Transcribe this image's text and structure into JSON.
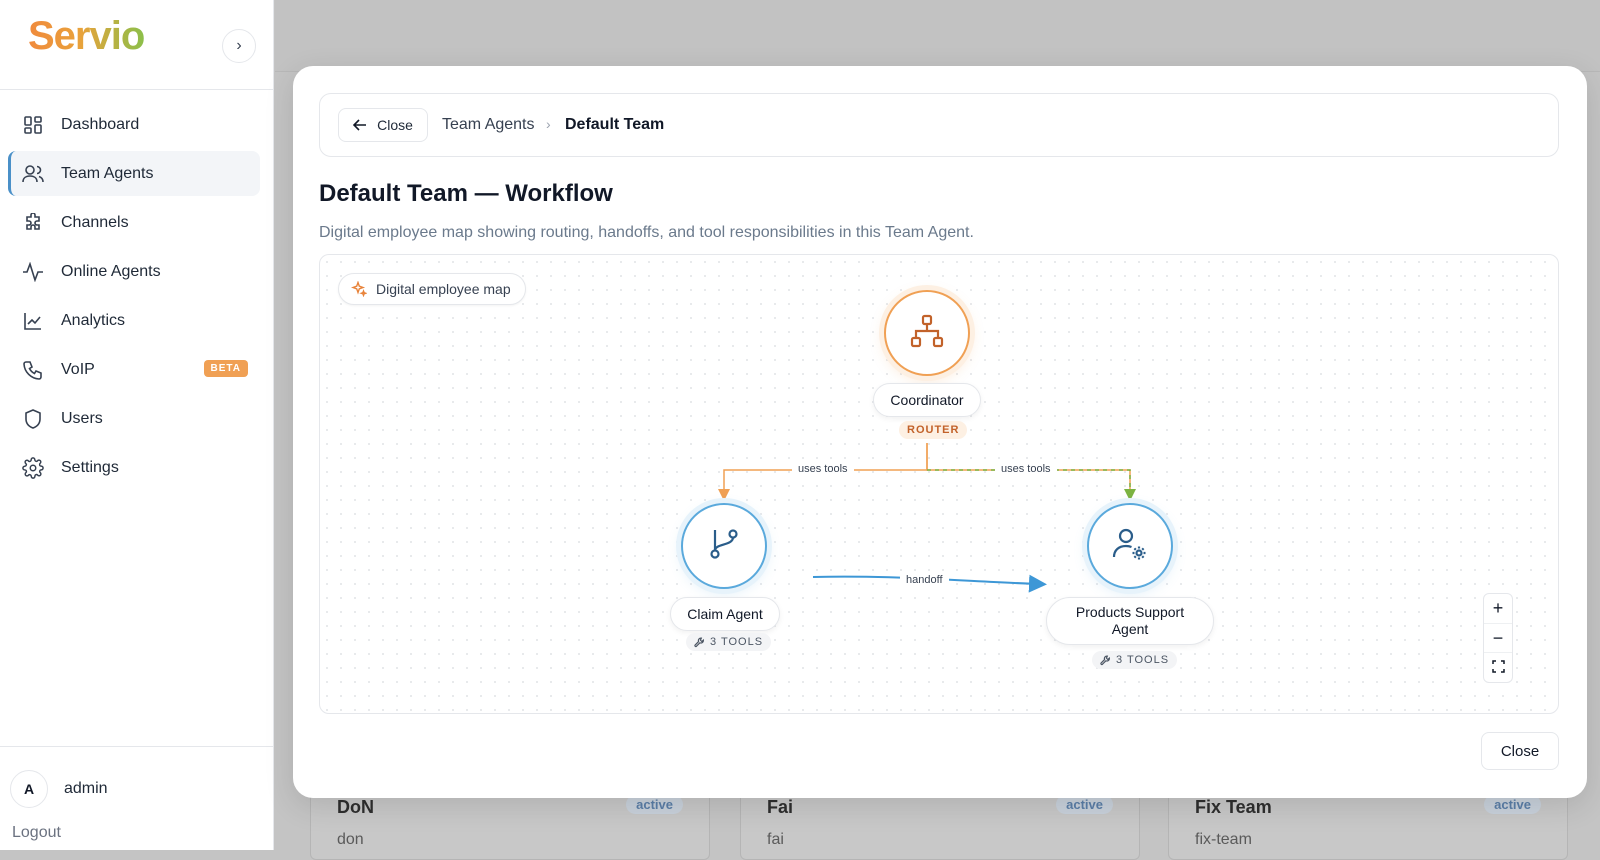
{
  "app": {
    "logo_text": "Servio",
    "collapse_glyph": "›"
  },
  "sidebar": {
    "items": [
      {
        "label": "Dashboard",
        "icon": "grid-icon"
      },
      {
        "label": "Team Agents",
        "icon": "users-icon",
        "active": true
      },
      {
        "label": "Channels",
        "icon": "puzzle-icon"
      },
      {
        "label": "Online Agents",
        "icon": "activity-icon"
      },
      {
        "label": "Analytics",
        "icon": "line-chart-icon"
      },
      {
        "label": "VoIP",
        "icon": "phone-icon",
        "badge": "BETA"
      },
      {
        "label": "Users",
        "icon": "shield-icon"
      },
      {
        "label": "Settings",
        "icon": "gear-icon"
      }
    ],
    "user": {
      "initial": "A",
      "name": "admin"
    },
    "logout_label": "Logout"
  },
  "background": {
    "cards": [
      {
        "title": "DoN",
        "slug": "don",
        "status": "active"
      },
      {
        "title": "Fai",
        "slug": "fai",
        "status": "active"
      },
      {
        "title": "Fix Team",
        "slug": "fix-team",
        "status": "active"
      }
    ]
  },
  "modal": {
    "close_label": "Close",
    "breadcrumb": {
      "parent": "Team Agents",
      "current": "Default Team",
      "separator": "›"
    },
    "title": "Default Team — Workflow",
    "subtitle": "Digital employee map showing routing, handoffs, and tool responsibilities in this Team Agent.",
    "map_chip": "Digital employee map",
    "footer_close_label": "Close",
    "zoom": {
      "in": "+",
      "out": "−",
      "fit": "⛶"
    }
  },
  "workflow": {
    "nodes": {
      "coordinator": {
        "label": "Coordinator",
        "tag": "ROUTER",
        "icon": "hierarchy-icon"
      },
      "claim": {
        "label": "Claim Agent",
        "tools": "3 TOOLS",
        "icon": "git-branch-icon"
      },
      "products": {
        "label": "Products Support Agent",
        "tools": "3 TOOLS",
        "icon": "user-gear-icon"
      }
    },
    "edges": [
      {
        "from": "Coordinator",
        "to": "Claim Agent",
        "label": "uses tools"
      },
      {
        "from": "Coordinator",
        "to": "Products Support Agent",
        "label": "uses tools"
      },
      {
        "from": "Claim Agent",
        "to": "Products Support Agent",
        "label": "handoff"
      }
    ]
  },
  "colors": {
    "accent_orange": "#f0a054",
    "accent_blue": "#5aa9dc",
    "accent_green": "#7cb342",
    "active_bar": "#4a90c8"
  }
}
